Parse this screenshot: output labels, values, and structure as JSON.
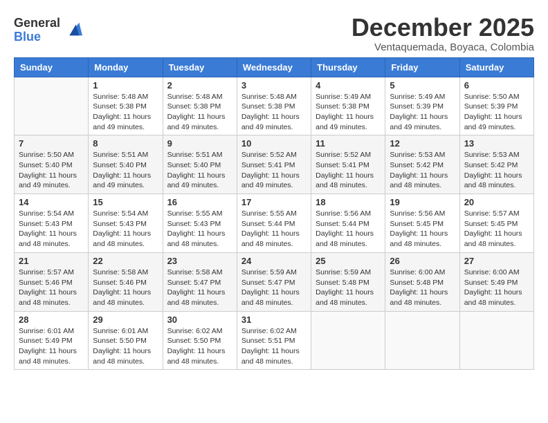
{
  "logo": {
    "general": "General",
    "blue": "Blue"
  },
  "title": "December 2025",
  "subtitle": "Ventaquemada, Boyaca, Colombia",
  "days_of_week": [
    "Sunday",
    "Monday",
    "Tuesday",
    "Wednesday",
    "Thursday",
    "Friday",
    "Saturday"
  ],
  "weeks": [
    [
      {
        "day": "",
        "info": ""
      },
      {
        "day": "1",
        "info": "Sunrise: 5:48 AM\nSunset: 5:38 PM\nDaylight: 11 hours\nand 49 minutes."
      },
      {
        "day": "2",
        "info": "Sunrise: 5:48 AM\nSunset: 5:38 PM\nDaylight: 11 hours\nand 49 minutes."
      },
      {
        "day": "3",
        "info": "Sunrise: 5:48 AM\nSunset: 5:38 PM\nDaylight: 11 hours\nand 49 minutes."
      },
      {
        "day": "4",
        "info": "Sunrise: 5:49 AM\nSunset: 5:38 PM\nDaylight: 11 hours\nand 49 minutes."
      },
      {
        "day": "5",
        "info": "Sunrise: 5:49 AM\nSunset: 5:39 PM\nDaylight: 11 hours\nand 49 minutes."
      },
      {
        "day": "6",
        "info": "Sunrise: 5:50 AM\nSunset: 5:39 PM\nDaylight: 11 hours\nand 49 minutes."
      }
    ],
    [
      {
        "day": "7",
        "info": "Sunrise: 5:50 AM\nSunset: 5:40 PM\nDaylight: 11 hours\nand 49 minutes."
      },
      {
        "day": "8",
        "info": "Sunrise: 5:51 AM\nSunset: 5:40 PM\nDaylight: 11 hours\nand 49 minutes."
      },
      {
        "day": "9",
        "info": "Sunrise: 5:51 AM\nSunset: 5:40 PM\nDaylight: 11 hours\nand 49 minutes."
      },
      {
        "day": "10",
        "info": "Sunrise: 5:52 AM\nSunset: 5:41 PM\nDaylight: 11 hours\nand 49 minutes."
      },
      {
        "day": "11",
        "info": "Sunrise: 5:52 AM\nSunset: 5:41 PM\nDaylight: 11 hours\nand 48 minutes."
      },
      {
        "day": "12",
        "info": "Sunrise: 5:53 AM\nSunset: 5:42 PM\nDaylight: 11 hours\nand 48 minutes."
      },
      {
        "day": "13",
        "info": "Sunrise: 5:53 AM\nSunset: 5:42 PM\nDaylight: 11 hours\nand 48 minutes."
      }
    ],
    [
      {
        "day": "14",
        "info": "Sunrise: 5:54 AM\nSunset: 5:43 PM\nDaylight: 11 hours\nand 48 minutes."
      },
      {
        "day": "15",
        "info": "Sunrise: 5:54 AM\nSunset: 5:43 PM\nDaylight: 11 hours\nand 48 minutes."
      },
      {
        "day": "16",
        "info": "Sunrise: 5:55 AM\nSunset: 5:43 PM\nDaylight: 11 hours\nand 48 minutes."
      },
      {
        "day": "17",
        "info": "Sunrise: 5:55 AM\nSunset: 5:44 PM\nDaylight: 11 hours\nand 48 minutes."
      },
      {
        "day": "18",
        "info": "Sunrise: 5:56 AM\nSunset: 5:44 PM\nDaylight: 11 hours\nand 48 minutes."
      },
      {
        "day": "19",
        "info": "Sunrise: 5:56 AM\nSunset: 5:45 PM\nDaylight: 11 hours\nand 48 minutes."
      },
      {
        "day": "20",
        "info": "Sunrise: 5:57 AM\nSunset: 5:45 PM\nDaylight: 11 hours\nand 48 minutes."
      }
    ],
    [
      {
        "day": "21",
        "info": "Sunrise: 5:57 AM\nSunset: 5:46 PM\nDaylight: 11 hours\nand 48 minutes."
      },
      {
        "day": "22",
        "info": "Sunrise: 5:58 AM\nSunset: 5:46 PM\nDaylight: 11 hours\nand 48 minutes."
      },
      {
        "day": "23",
        "info": "Sunrise: 5:58 AM\nSunset: 5:47 PM\nDaylight: 11 hours\nand 48 minutes."
      },
      {
        "day": "24",
        "info": "Sunrise: 5:59 AM\nSunset: 5:47 PM\nDaylight: 11 hours\nand 48 minutes."
      },
      {
        "day": "25",
        "info": "Sunrise: 5:59 AM\nSunset: 5:48 PM\nDaylight: 11 hours\nand 48 minutes."
      },
      {
        "day": "26",
        "info": "Sunrise: 6:00 AM\nSunset: 5:48 PM\nDaylight: 11 hours\nand 48 minutes."
      },
      {
        "day": "27",
        "info": "Sunrise: 6:00 AM\nSunset: 5:49 PM\nDaylight: 11 hours\nand 48 minutes."
      }
    ],
    [
      {
        "day": "28",
        "info": "Sunrise: 6:01 AM\nSunset: 5:49 PM\nDaylight: 11 hours\nand 48 minutes."
      },
      {
        "day": "29",
        "info": "Sunrise: 6:01 AM\nSunset: 5:50 PM\nDaylight: 11 hours\nand 48 minutes."
      },
      {
        "day": "30",
        "info": "Sunrise: 6:02 AM\nSunset: 5:50 PM\nDaylight: 11 hours\nand 48 minutes."
      },
      {
        "day": "31",
        "info": "Sunrise: 6:02 AM\nSunset: 5:51 PM\nDaylight: 11 hours\nand 48 minutes."
      },
      {
        "day": "",
        "info": ""
      },
      {
        "day": "",
        "info": ""
      },
      {
        "day": "",
        "info": ""
      }
    ]
  ]
}
